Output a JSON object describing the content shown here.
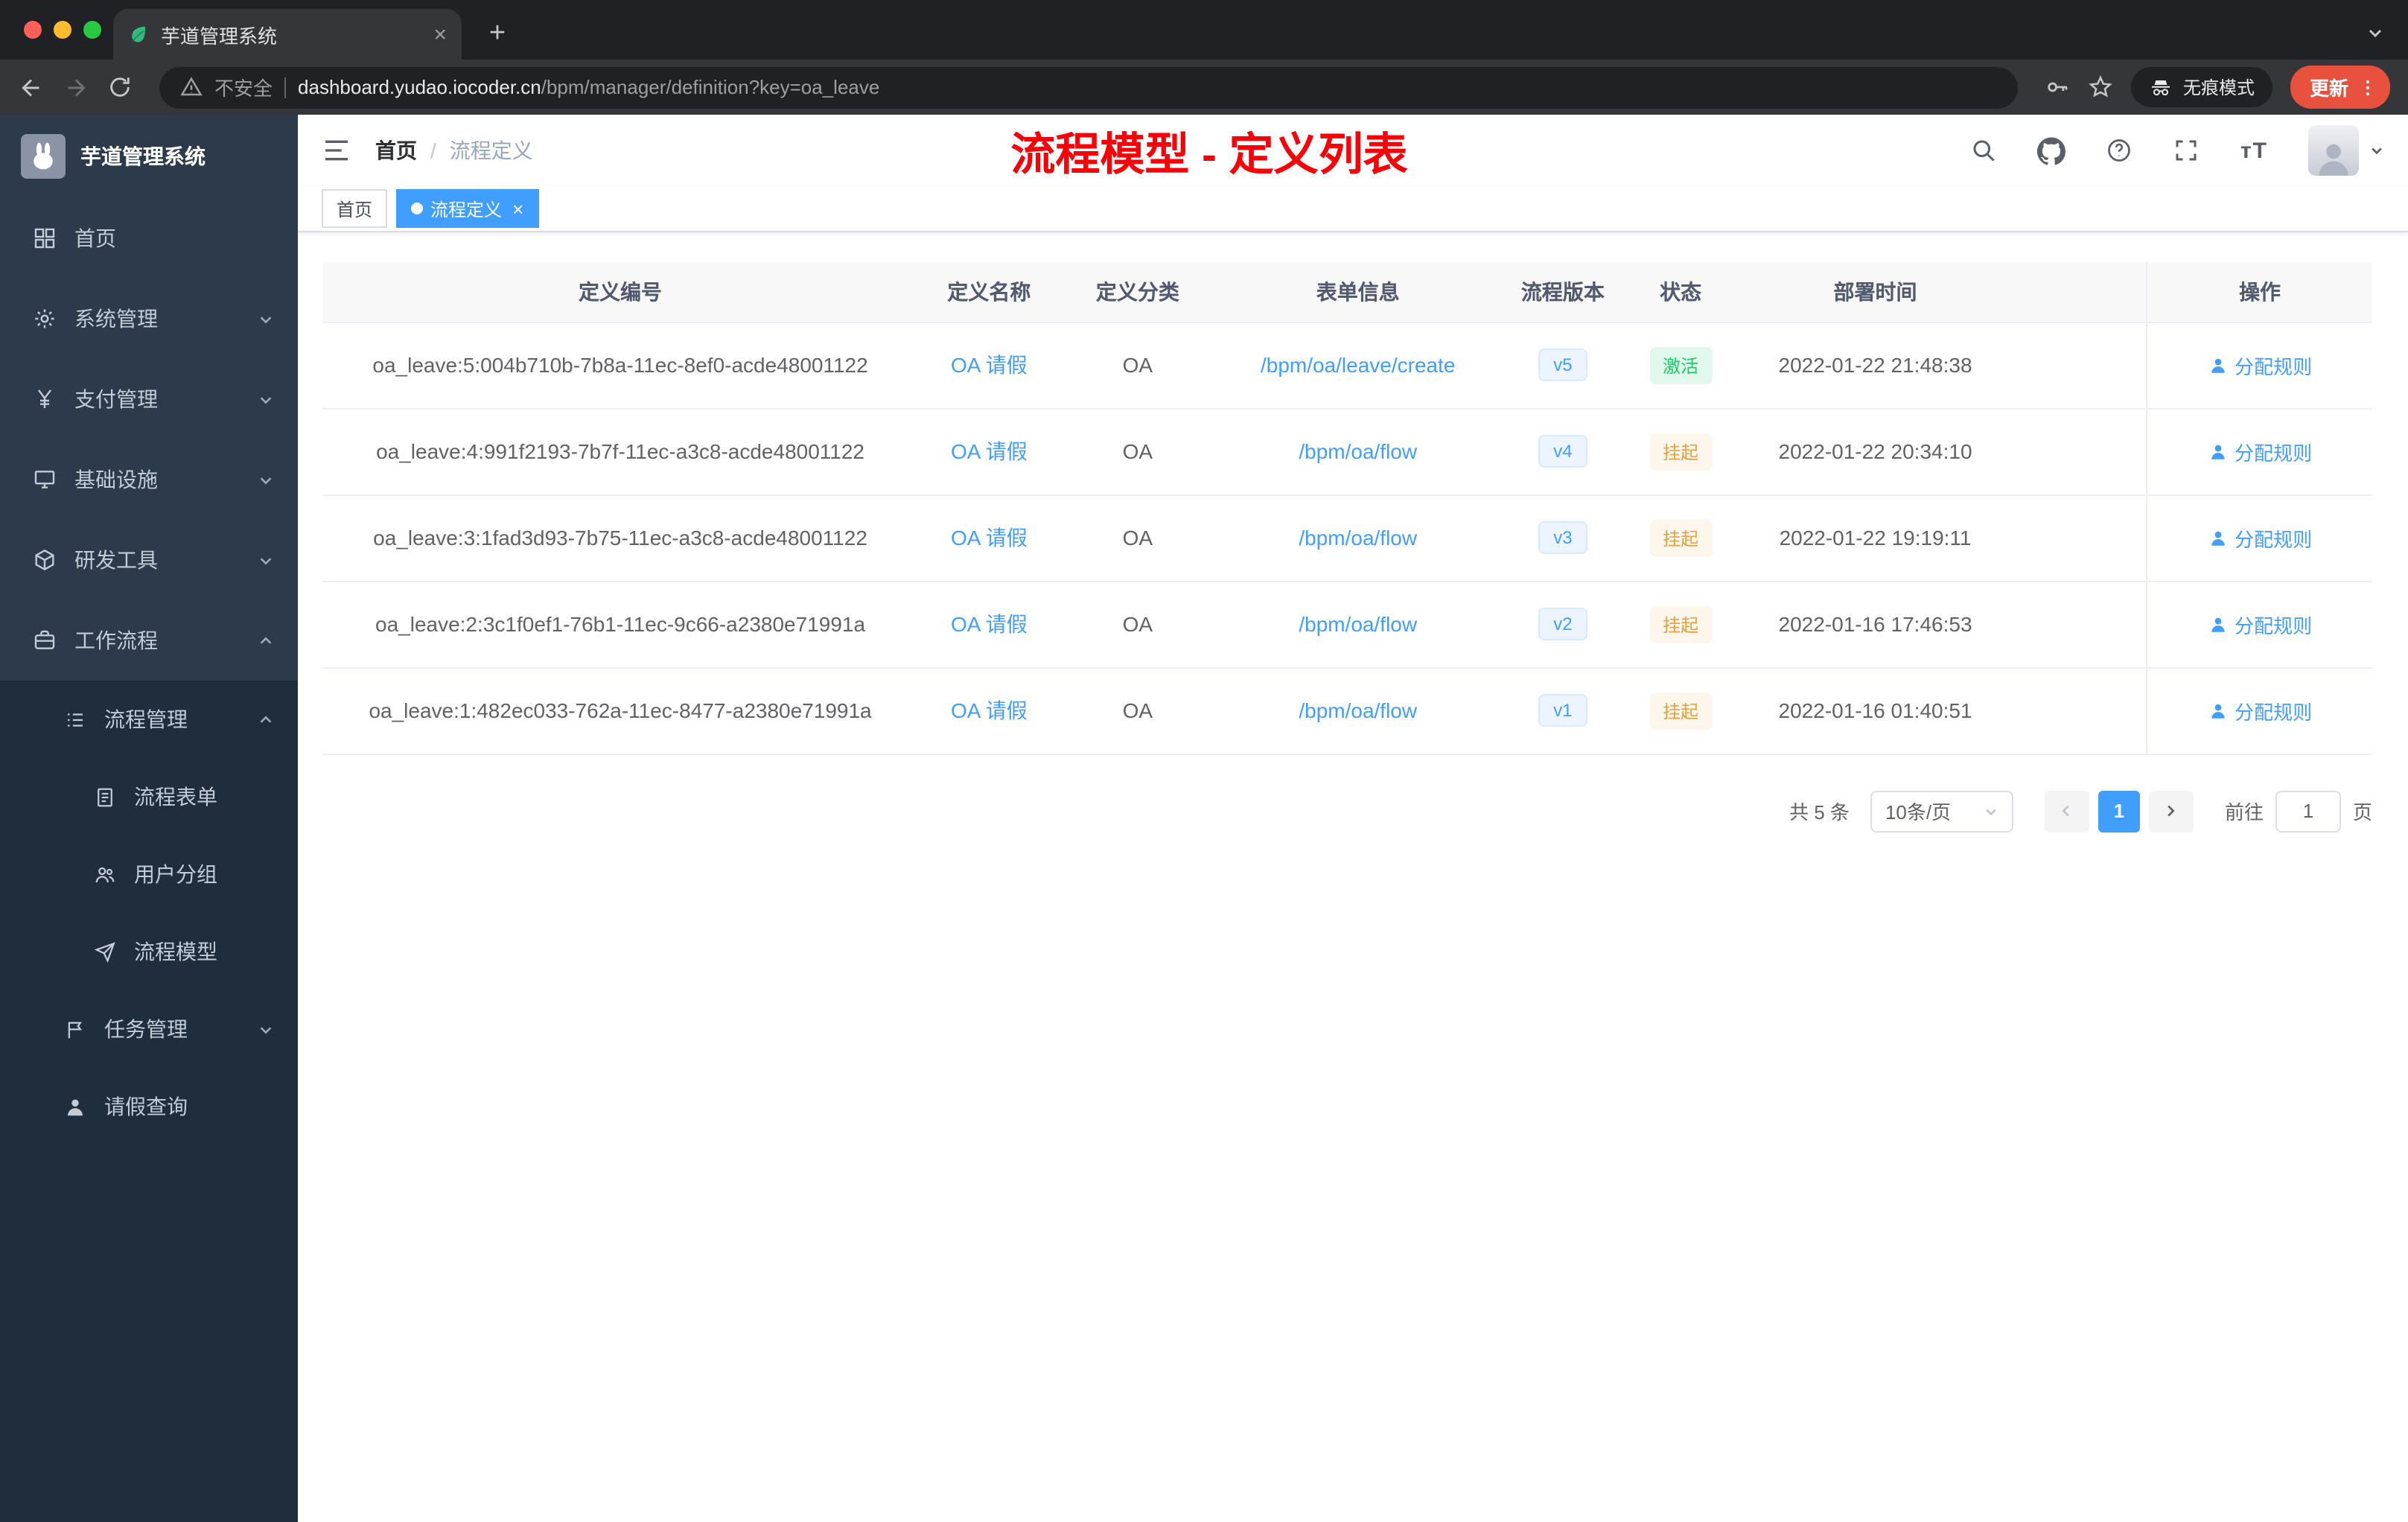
{
  "colors": {
    "accent": "#409eff",
    "success": "#13ce66",
    "warning": "#e6a23c",
    "annotation_red": "#fb0007",
    "sidebar_bg": "#2d3a4b",
    "sidebar_sub_bg": "#1f2d3d"
  },
  "icons": [
    "leaf-favicon-icon",
    "tab-close-icon",
    "new-tab-icon",
    "tab-overflow-chevron-icon",
    "back-icon",
    "forward-icon",
    "reload-icon",
    "warning-icon",
    "key-icon",
    "star-icon",
    "incognito-icon",
    "kebab-menu-icon",
    "rabbit-logo-icon",
    "dashboard-icon",
    "gear-icon",
    "payment-icon",
    "infrastructure-icon",
    "devtools-icon",
    "workflow-icon",
    "process-manage-icon",
    "process-form-icon",
    "user-group-icon",
    "process-model-icon",
    "task-manage-icon",
    "leave-query-icon",
    "chevron-down-icon",
    "chevron-up-icon",
    "hamburger-icon",
    "search-icon",
    "github-icon",
    "question-icon",
    "fullscreen-icon",
    "font-size-icon",
    "avatar",
    "user-icon",
    "prev-page-icon",
    "next-page-icon"
  ],
  "browser": {
    "tab_title": "芋道管理系统",
    "security_label": "不安全",
    "url_host": "dashboard.yudao.iocoder.cn",
    "url_path": "/bpm/manager/definition?key=oa_leave",
    "incognito_label": "无痕模式",
    "update_label": "更新"
  },
  "sidebar": {
    "logo_title": "芋道管理系统",
    "items": [
      {
        "label": "首页",
        "icon": "dashboard-icon",
        "level": 1
      },
      {
        "label": "系统管理",
        "icon": "gear-icon",
        "level": 1,
        "state": "collapsed"
      },
      {
        "label": "支付管理",
        "icon": "payment-icon",
        "level": 1,
        "state": "collapsed"
      },
      {
        "label": "基础设施",
        "icon": "infrastructure-icon",
        "level": 1,
        "state": "collapsed"
      },
      {
        "label": "研发工具",
        "icon": "devtools-icon",
        "level": 1,
        "state": "collapsed"
      },
      {
        "label": "工作流程",
        "icon": "workflow-icon",
        "level": 1,
        "state": "expanded"
      },
      {
        "label": "流程管理",
        "icon": "process-manage-icon",
        "level": 2,
        "state": "expanded"
      },
      {
        "label": "流程表单",
        "icon": "process-form-icon",
        "level": 3
      },
      {
        "label": "用户分组",
        "icon": "user-group-icon",
        "level": 3
      },
      {
        "label": "流程模型",
        "icon": "process-model-icon",
        "level": 3
      },
      {
        "label": "任务管理",
        "icon": "task-manage-icon",
        "level": 2,
        "state": "collapsed"
      },
      {
        "label": "请假查询",
        "icon": "leave-query-icon",
        "level": 2
      }
    ]
  },
  "header": {
    "breadcrumb_home": "首页",
    "breadcrumb_separator": "/",
    "breadcrumb_current": "流程定义",
    "annotation": "流程模型 - 定义列表"
  },
  "tags": {
    "home": "首页",
    "active": "流程定义"
  },
  "table": {
    "columns": [
      "定义编号",
      "定义名称",
      "定义分类",
      "表单信息",
      "流程版本",
      "状态",
      "部署时间",
      "操作"
    ],
    "rows": [
      {
        "id": "oa_leave:5:004b710b-7b8a-11ec-8ef0-acde48001122",
        "name": "OA 请假",
        "category": "OA",
        "form": "/bpm/oa/leave/create",
        "version": "v5",
        "status": "激活",
        "status_type": "success",
        "time": "2022-01-22 21:48:38",
        "action": "分配规则"
      },
      {
        "id": "oa_leave:4:991f2193-7b7f-11ec-a3c8-acde48001122",
        "name": "OA 请假",
        "category": "OA",
        "form": "/bpm/oa/flow",
        "version": "v4",
        "status": "挂起",
        "status_type": "warning",
        "time": "2022-01-22 20:34:10",
        "action": "分配规则"
      },
      {
        "id": "oa_leave:3:1fad3d93-7b75-11ec-a3c8-acde48001122",
        "name": "OA 请假",
        "category": "OA",
        "form": "/bpm/oa/flow",
        "version": "v3",
        "status": "挂起",
        "status_type": "warning",
        "time": "2022-01-22 19:19:11",
        "action": "分配规则"
      },
      {
        "id": "oa_leave:2:3c1f0ef1-76b1-11ec-9c66-a2380e71991a",
        "name": "OA 请假",
        "category": "OA",
        "form": "/bpm/oa/flow",
        "version": "v2",
        "status": "挂起",
        "status_type": "warning",
        "time": "2022-01-16 17:46:53",
        "action": "分配规则"
      },
      {
        "id": "oa_leave:1:482ec033-762a-11ec-8477-a2380e71991a",
        "name": "OA 请假",
        "category": "OA",
        "form": "/bpm/oa/flow",
        "version": "v1",
        "status": "挂起",
        "status_type": "warning",
        "time": "2022-01-16 01:40:51",
        "action": "分配规则"
      }
    ]
  },
  "pagination": {
    "total_label": "共 5 条",
    "page_size_label": "10条/页",
    "current_page": "1",
    "goto_prefix": "前往",
    "goto_value": "1",
    "goto_suffix": "页"
  }
}
